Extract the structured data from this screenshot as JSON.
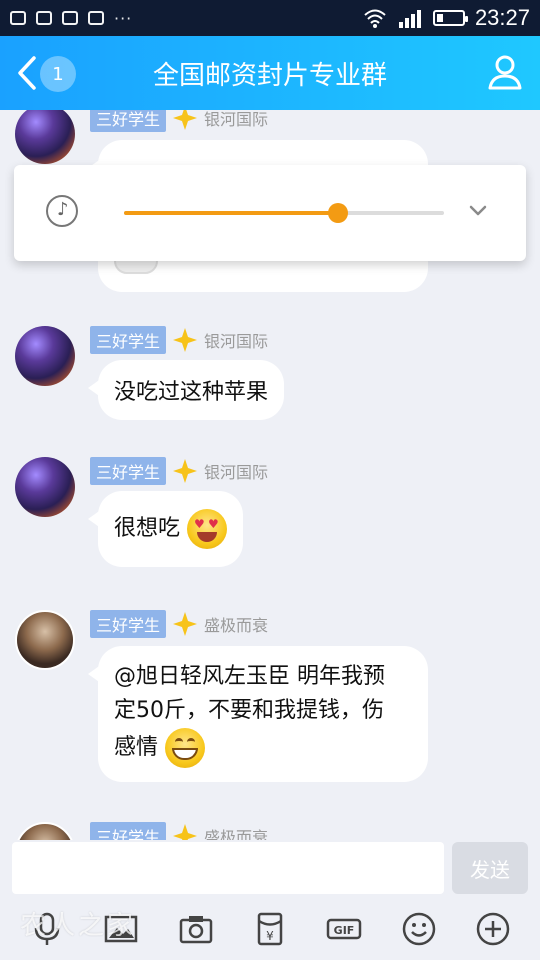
{
  "status_bar": {
    "time": "23:27",
    "more": "···"
  },
  "header": {
    "badge_count": "1",
    "title": "全国邮资封片专业群"
  },
  "messages": [
    {
      "rank": "三好学生",
      "nickname": "银河国际"
    },
    {
      "rank": "三好学生",
      "nickname": "银河国际",
      "text": "没吃过这种苹果"
    },
    {
      "rank": "三好学生",
      "nickname": "银河国际",
      "text": "很想吃"
    },
    {
      "rank": "三好学生",
      "nickname": "盛极而衰",
      "text_line1": "@旭日轻风左玉臣 明年我预",
      "text_line2": "定50斤，不要和我提钱，伤",
      "text_line3": "感情"
    },
    {
      "rank": "三好学生",
      "nickname": "盛极而衰"
    }
  ],
  "audio": {
    "progress": 0.67,
    "accent": "#f39b13"
  },
  "composer": {
    "input_value": "",
    "send_label": "发送"
  },
  "toolbar": {
    "icons": [
      "microphone-icon",
      "image-icon",
      "camera-icon",
      "red-packet-icon",
      "gif-icon",
      "emoji-icon",
      "plus-icon"
    ]
  },
  "watermark": "农人之家"
}
